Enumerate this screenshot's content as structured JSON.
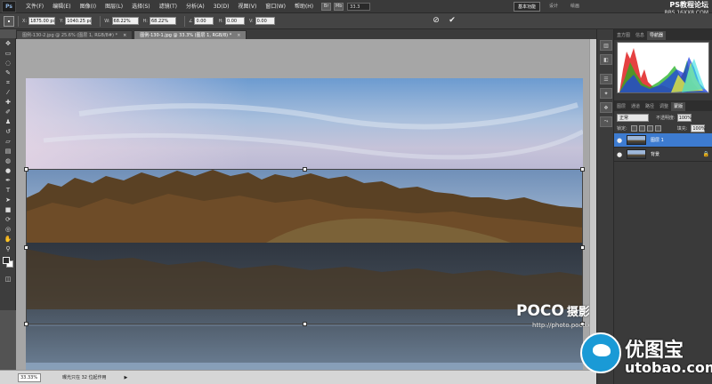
{
  "app": {
    "logo": "Ps"
  },
  "menu": [
    "文件(F)",
    "编辑(E)",
    "图像(I)",
    "图层(L)",
    "选择(S)",
    "滤镜(T)",
    "分析(A)",
    "3D(D)",
    "视图(V)",
    "窗口(W)",
    "帮助(H)"
  ],
  "menubar_icons": [
    "Br",
    "Mb"
  ],
  "zoom_select": "33.3",
  "workspace": {
    "active": "基本功能",
    "links": [
      "设计",
      "绘画"
    ]
  },
  "site_watermark": {
    "title": "PS教程论坛",
    "url": "BBS.16XX8.COM"
  },
  "options": {
    "x_label": "X:",
    "x_value": "1875.00 px",
    "y_label": "Y:",
    "y_value": "1040.25 px",
    "w_label": "W:",
    "w_value": "68.22%",
    "h_label": "H:",
    "h_value": "68.22%",
    "angle_value": "0.00",
    "h_skew_label": "H:",
    "h_skew_value": "0.00",
    "v_skew_label": "V:",
    "v_skew_value": "0.00",
    "cancel_glyph": "⊘",
    "commit_glyph": "✔"
  },
  "tabs": [
    {
      "label": "图例-130-2.jpg @ 25.6% (图层 1, RGB/8#) *",
      "active": false,
      "close": "×"
    },
    {
      "label": "图例-130-1.jpg @ 33.3% (图层 1, RGB/8) *",
      "active": true,
      "close": "×"
    }
  ],
  "canvas_watermark": {
    "brand": "POCO",
    "sub": "摄影专题",
    "url": "http://photo.poco.cn/"
  },
  "status": {
    "zoom": "33.33%",
    "text": "曝光只在 32 位起作用",
    "arrow": "▶"
  },
  "panels": {
    "top_tabs": [
      "直方图",
      "信息",
      "导航器"
    ],
    "layer_tabs": [
      "图层",
      "通道",
      "路径",
      "调整",
      "蒙版"
    ],
    "blend_mode": "正常",
    "opacity_label": "不透明度:",
    "opacity_value": "100%",
    "lock_label": "锁定:",
    "fill_label": "填充:",
    "fill_value": "100%",
    "layers": [
      {
        "name": "图层 1",
        "selected": true,
        "eye": "●"
      },
      {
        "name": "背景",
        "selected": false,
        "eye": "●",
        "lock": "🔒"
      }
    ]
  },
  "brand_watermark": {
    "cn": "优图宝",
    "en": "utobao.com"
  },
  "colors": {
    "selection": "#3d7bd0",
    "accent": "#1a9ad6"
  }
}
